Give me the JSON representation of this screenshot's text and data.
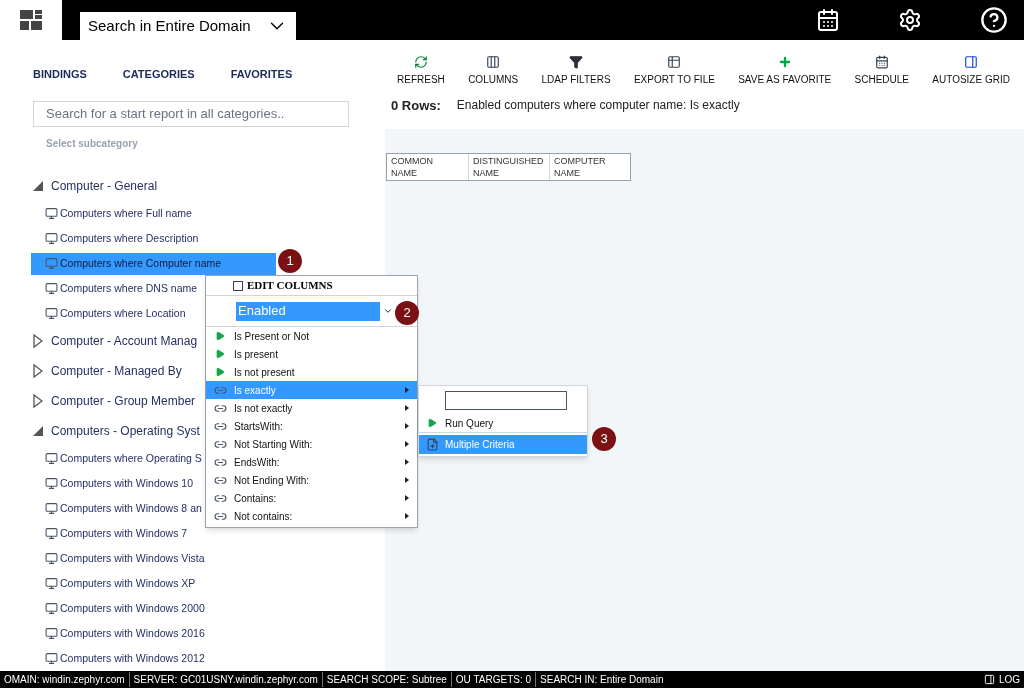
{
  "top_bar": {
    "scope_dropdown": "Search in Entire Domain"
  },
  "left_tabs": [
    {
      "label": "BINDINGS"
    },
    {
      "label": "CATEGORIES"
    },
    {
      "label": "FAVORITES"
    }
  ],
  "search": {
    "placeholder": "Search for a start report in all categories.."
  },
  "subcategory_label": "Select subcategory",
  "tree": [
    {
      "label": "Computer - General",
      "expanded": true,
      "children": [
        {
          "label": "Computers where Full name",
          "selected": false
        },
        {
          "label": "Computers where Description",
          "selected": false
        },
        {
          "label": "Computers where Computer name",
          "selected": true
        },
        {
          "label": "Computers where DNS name",
          "selected": false
        },
        {
          "label": "Computers where Location",
          "selected": false
        }
      ]
    },
    {
      "label": "Computer - Account Manag",
      "expanded": false
    },
    {
      "label": "Computer - Managed By",
      "expanded": false
    },
    {
      "label": "Computer - Group Member",
      "expanded": false
    },
    {
      "label": "Computers - Operating Syst",
      "expanded": true,
      "children": [
        {
          "label": "Computers where Operating S",
          "selected": false
        },
        {
          "label": "Computers with Windows 10",
          "selected": false
        },
        {
          "label": "Computers with Windows 8 an",
          "selected": false
        },
        {
          "label": "Computers with Windows 7",
          "selected": false
        },
        {
          "label": "Computers with Windows Vista",
          "selected": false
        },
        {
          "label": "Computers with Windows XP",
          "selected": false
        },
        {
          "label": "Computers with Windows 2000",
          "selected": false
        },
        {
          "label": "Computers with Windows 2016",
          "selected": false
        },
        {
          "label": "Computers with Windows 2012",
          "selected": false
        }
      ]
    }
  ],
  "toolbar": [
    {
      "label": "REFRESH",
      "kind": "refresh"
    },
    {
      "label": "COLUMNS",
      "kind": "columns"
    },
    {
      "label": "LDAP FILTERS",
      "kind": "filter"
    },
    {
      "label": "EXPORT TO FILE",
      "kind": "export"
    },
    {
      "label": "SAVE AS FAVORITE",
      "kind": "add"
    },
    {
      "label": "SCHEDULE",
      "kind": "schedule"
    },
    {
      "label": "AUTOSIZE GRID",
      "kind": "autosize"
    }
  ],
  "result": {
    "rows": "0 Rows:",
    "description": "Enabled computers where computer name: Is exactly"
  },
  "table": {
    "columns": [
      [
        "COMMON",
        "NAME"
      ],
      [
        "DISTINGUISHED",
        "NAME"
      ],
      [
        "COMPUTER",
        "NAME"
      ]
    ]
  },
  "context_menu": {
    "header": "EDIT COLUMNS",
    "header_checked": false,
    "filter_value": "Enabled",
    "items": [
      {
        "label": "Is Present or Not",
        "kind": "action",
        "selected": false
      },
      {
        "label": "Is present",
        "kind": "action",
        "selected": false
      },
      {
        "label": "Is not present",
        "kind": "action",
        "selected": false
      },
      {
        "label": "Is exactly",
        "kind": "operator",
        "selected": true
      },
      {
        "label": "Is not exactly",
        "kind": "operator",
        "selected": false
      },
      {
        "label": "StartsWith:",
        "kind": "operator",
        "selected": false
      },
      {
        "label": "Not Starting With:",
        "kind": "operator",
        "selected": false
      },
      {
        "label": "EndsWith:",
        "kind": "operator",
        "selected": false
      },
      {
        "label": "Not Ending With:",
        "kind": "operator",
        "selected": false
      },
      {
        "label": "Contains:",
        "kind": "operator",
        "selected": false
      },
      {
        "label": "Not contains:",
        "kind": "operator",
        "selected": false
      }
    ]
  },
  "submenu": {
    "items": [
      {
        "label": "Run Query",
        "kind": "action",
        "selected": false
      },
      {
        "label": "Multiple Criteria",
        "kind": "criteria",
        "selected": true
      }
    ]
  },
  "callouts": [
    "1",
    "2",
    "3"
  ],
  "status_bar": [
    {
      "label": "OMAIN:",
      "value": "windin.zephyr.com"
    },
    {
      "label": "SERVER:",
      "value": "GC01USNY.windin.zephyr.com"
    },
    {
      "label": "SEARCH SCOPE:",
      "value": "Subtree"
    },
    {
      "label": "OU TARGETS:",
      "value": "0"
    },
    {
      "label": "SEARCH IN:",
      "value": "Entire Domain"
    }
  ],
  "log_button": "LOG"
}
